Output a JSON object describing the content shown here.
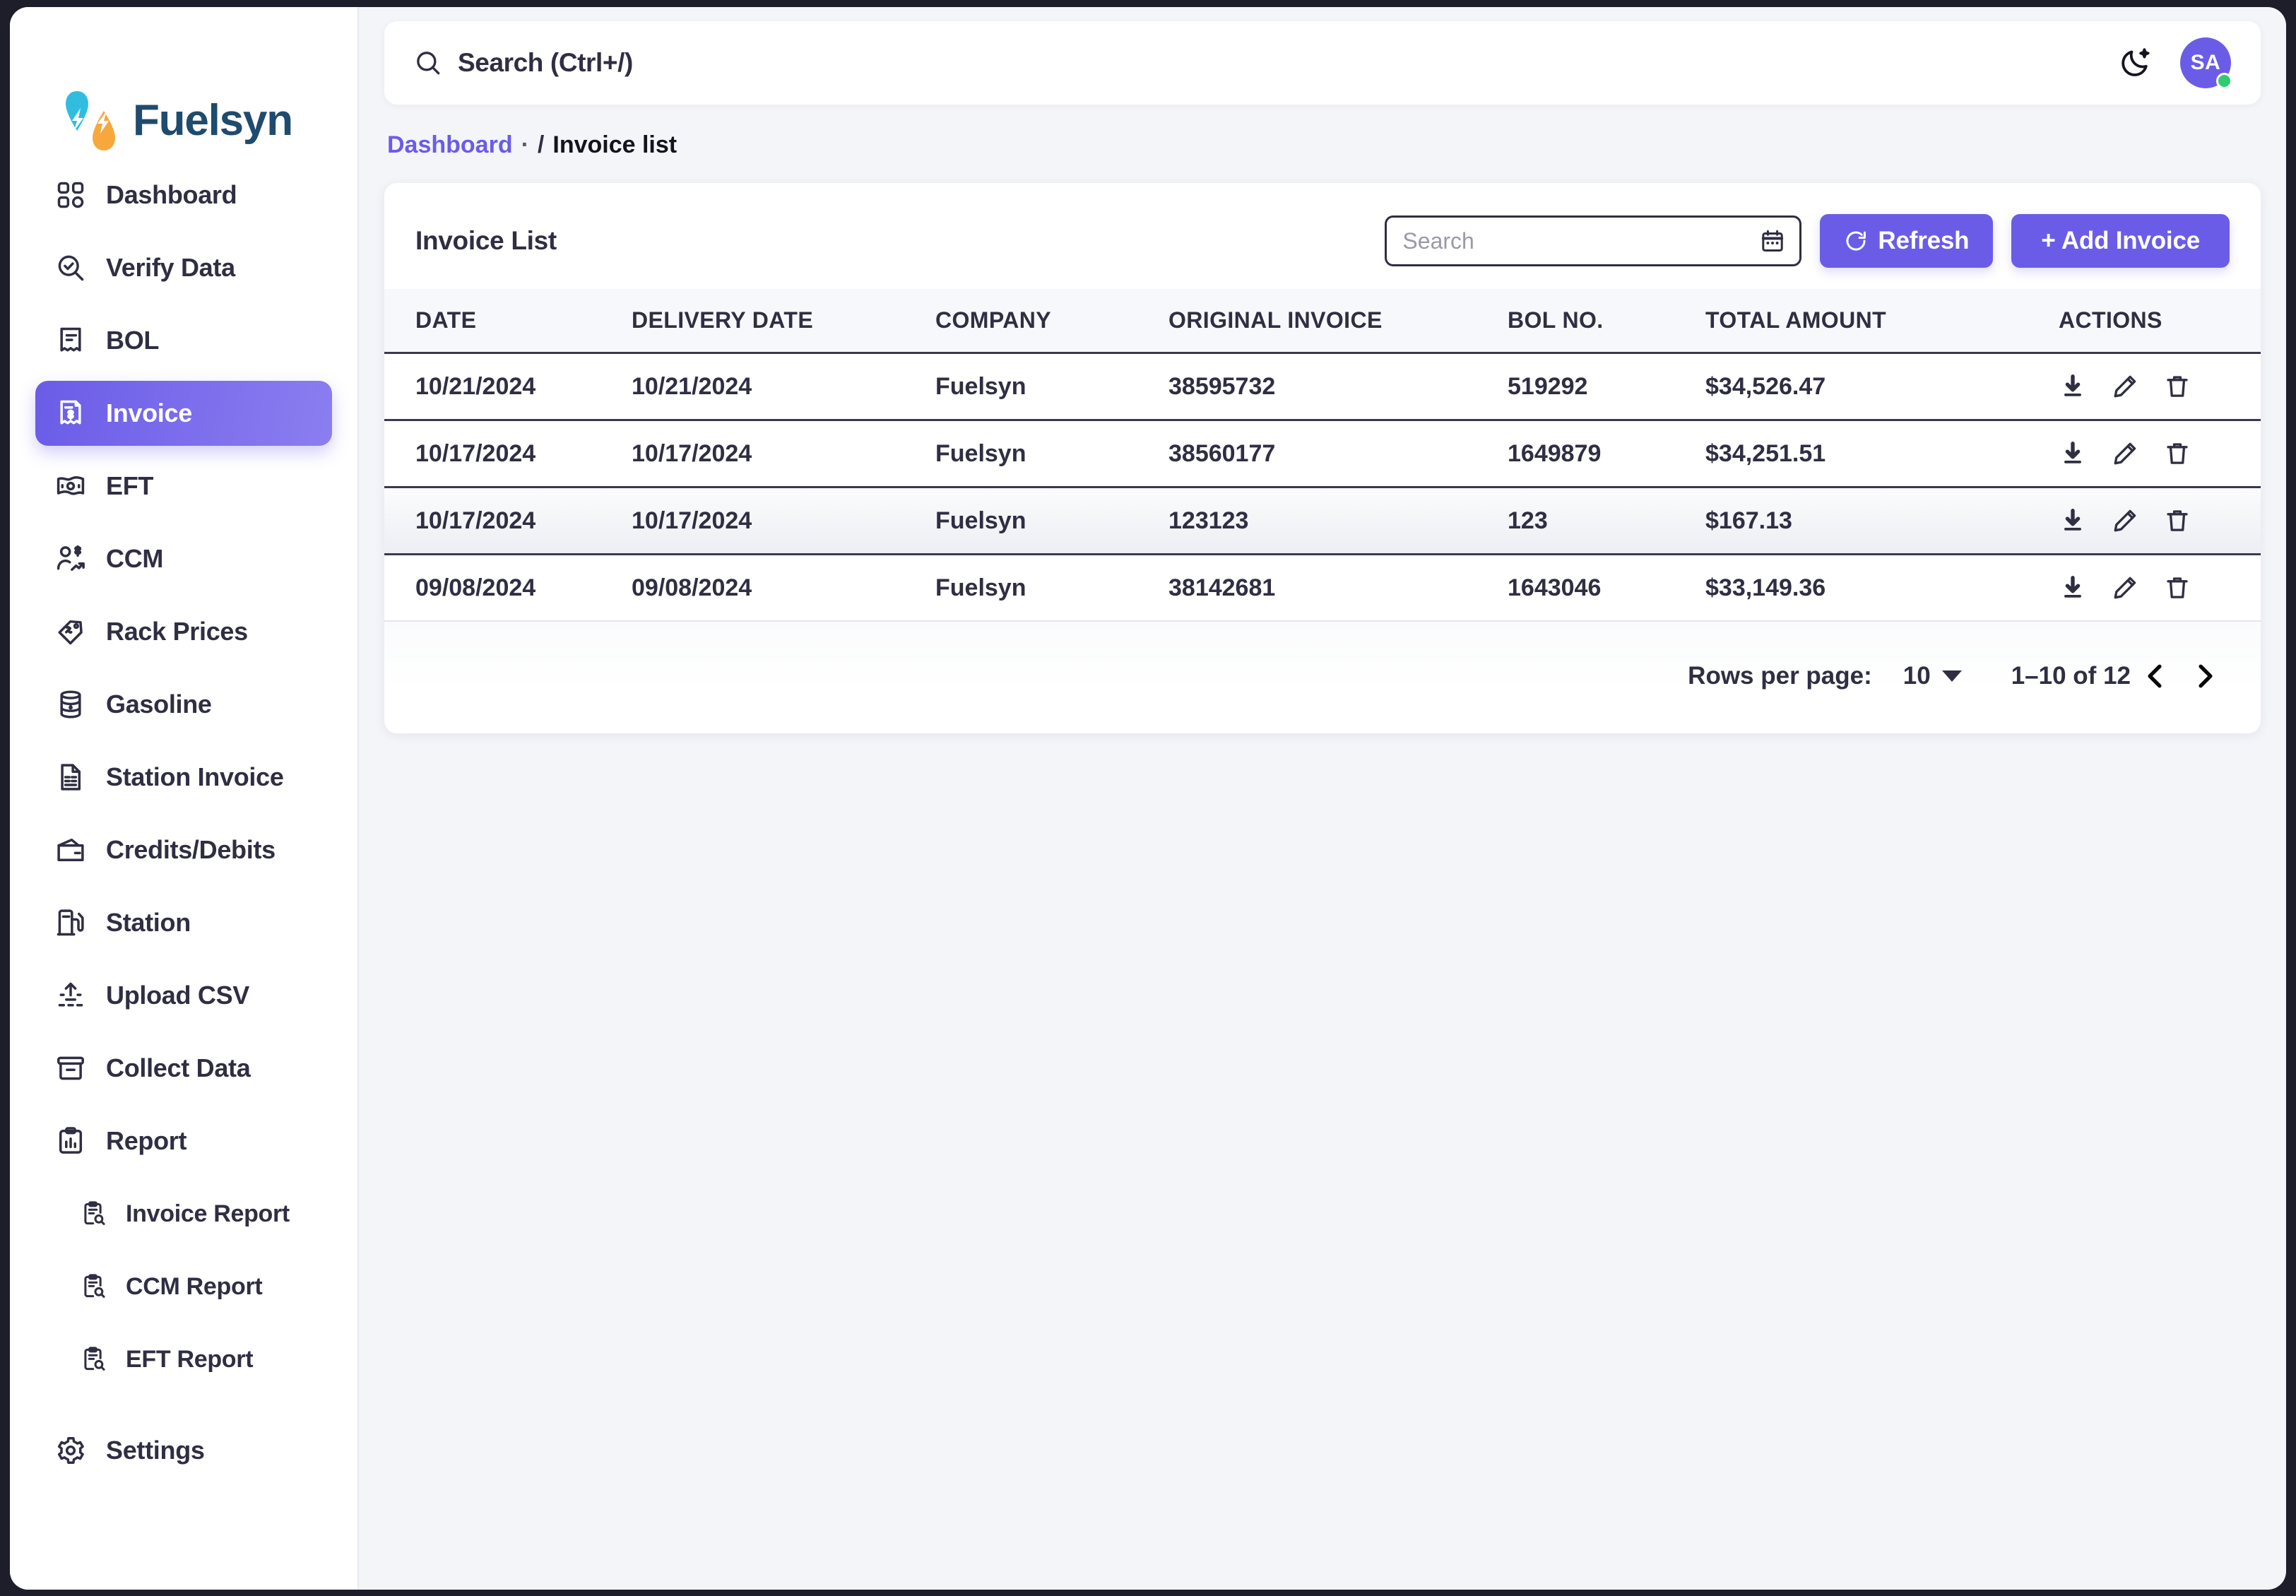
{
  "brand": {
    "name": "Fuelsyn"
  },
  "topbar": {
    "search_placeholder": "Search (Ctrl+/)",
    "theme_toggle": "moon-icon",
    "avatar_initials": "SA",
    "status": "online"
  },
  "breadcrumb": {
    "root": "Dashboard",
    "separator_dot": "·",
    "separator_slash": "/",
    "current": "Invoice list"
  },
  "sidebar": {
    "items": [
      {
        "label": "Dashboard",
        "icon": "grid-icon",
        "active": false,
        "sub": false
      },
      {
        "label": "Verify Data",
        "icon": "search-check-icon",
        "active": false,
        "sub": false
      },
      {
        "label": "BOL",
        "icon": "receipt-icon",
        "active": false,
        "sub": false
      },
      {
        "label": "Invoice",
        "icon": "invoice-dollar-icon",
        "active": true,
        "sub": false
      },
      {
        "label": "EFT",
        "icon": "banknote-icon",
        "active": false,
        "sub": false
      },
      {
        "label": "CCM",
        "icon": "user-dollar-icon",
        "active": false,
        "sub": false
      },
      {
        "label": "Rack Prices",
        "icon": "price-tag-icon",
        "active": false,
        "sub": false
      },
      {
        "label": "Gasoline",
        "icon": "oil-barrel-icon",
        "active": false,
        "sub": false
      },
      {
        "label": "Station Invoice",
        "icon": "document-icon",
        "active": false,
        "sub": false
      },
      {
        "label": "Credits/Debits",
        "icon": "wallet-icon",
        "active": false,
        "sub": false
      },
      {
        "label": "Station",
        "icon": "fuel-pump-icon",
        "active": false,
        "sub": false
      },
      {
        "label": "Upload CSV",
        "icon": "upload-icon",
        "active": false,
        "sub": false
      },
      {
        "label": "Collect Data",
        "icon": "archive-icon",
        "active": false,
        "sub": false
      },
      {
        "label": "Report",
        "icon": "clipboard-chart-icon",
        "active": false,
        "sub": false
      },
      {
        "label": "Invoice Report",
        "icon": "clipboard-search-icon",
        "active": false,
        "sub": true
      },
      {
        "label": "CCM Report",
        "icon": "clipboard-search-icon",
        "active": false,
        "sub": true
      },
      {
        "label": "EFT Report",
        "icon": "clipboard-search-icon",
        "active": false,
        "sub": true
      },
      {
        "label": "Settings",
        "icon": "gear-icon",
        "active": false,
        "sub": false
      }
    ]
  },
  "card": {
    "title": "Invoice List",
    "search_placeholder": "Search",
    "search_value": "",
    "calendar_icon": "calendar-icon",
    "refresh_label": "Refresh",
    "refresh_icon": "refresh-icon",
    "add_label": "+ Add Invoice"
  },
  "table": {
    "columns": [
      "DATE",
      "DELIVERY DATE",
      "COMPANY",
      "ORIGINAL INVOICE",
      "BOL NO.",
      "TOTAL AMOUNT",
      "ACTIONS"
    ],
    "rows": [
      {
        "date": "10/21/2024",
        "delivery_date": "10/21/2024",
        "company": "Fuelsyn",
        "original_invoice": "38595732",
        "bol_no": "519292",
        "total_amount": "$34,526.47",
        "highlighted": false
      },
      {
        "date": "10/17/2024",
        "delivery_date": "10/17/2024",
        "company": "Fuelsyn",
        "original_invoice": "38560177",
        "bol_no": "1649879",
        "total_amount": "$34,251.51",
        "highlighted": false
      },
      {
        "date": "10/17/2024",
        "delivery_date": "10/17/2024",
        "company": "Fuelsyn",
        "original_invoice": "123123",
        "bol_no": "123",
        "total_amount": "$167.13",
        "highlighted": true
      },
      {
        "date": "09/08/2024",
        "delivery_date": "09/08/2024",
        "company": "Fuelsyn",
        "original_invoice": "38142681",
        "bol_no": "1643046",
        "total_amount": "$33,149.36",
        "highlighted": false
      }
    ],
    "row_actions": [
      "download-icon",
      "edit-icon",
      "delete-icon"
    ]
  },
  "pagination": {
    "rows_per_page_label": "Rows per page:",
    "rows_per_page_value": "10",
    "range_label": "1–10 of 12",
    "prev_icon": "chevron-left-icon",
    "next_icon": "chevron-right-icon"
  },
  "colors": {
    "accent": "#6b5ce7",
    "accent_light": "#8b7ef0",
    "text": "#2f2e43",
    "page_bg": "#f4f5f9",
    "logo_cyan": "#31bde0",
    "logo_orange": "#f7a83c",
    "logo_navy": "#1f4b6e",
    "status_online": "#2ecc71"
  }
}
